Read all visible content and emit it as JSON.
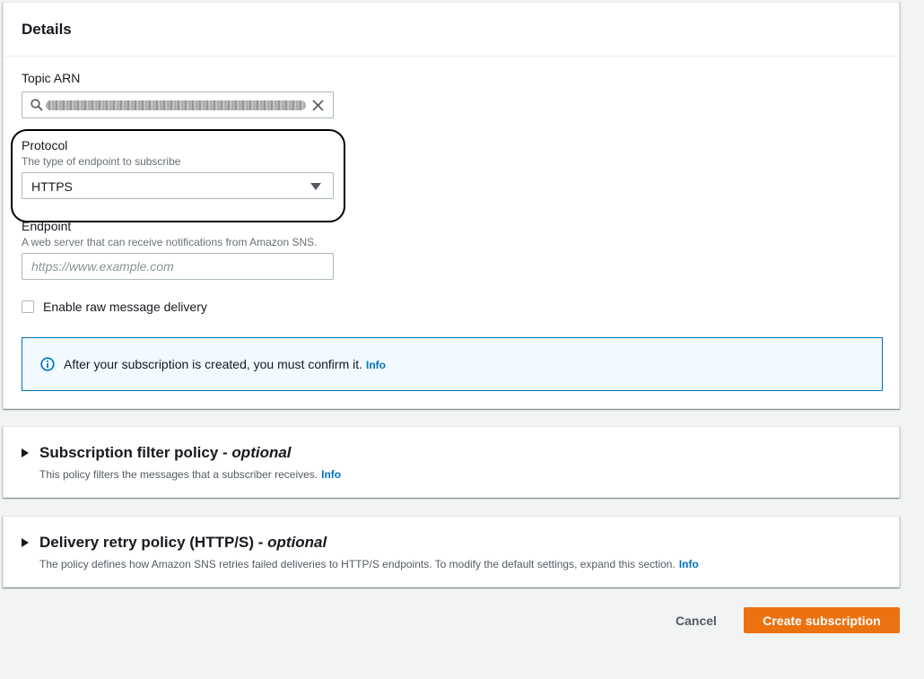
{
  "details": {
    "title": "Details",
    "topic_arn": {
      "label": "Topic ARN"
    },
    "protocol": {
      "label": "Protocol",
      "description": "The type of endpoint to subscribe",
      "selected": "HTTPS"
    },
    "endpoint": {
      "label": "Endpoint",
      "description": "A web server that can receive notifications from Amazon SNS.",
      "placeholder": "https://www.example.com"
    },
    "raw_delivery": {
      "label": "Enable raw message delivery",
      "checked": false
    },
    "alert": {
      "text": "After your subscription is created, you must confirm it.",
      "info_link": "Info"
    }
  },
  "filter_policy": {
    "title": "Subscription filter policy - ",
    "optional": "optional",
    "description": "This policy filters the messages that a subscriber receives.",
    "info_link": "Info"
  },
  "retry_policy": {
    "title": "Delivery retry policy (HTTP/S) - ",
    "optional": "optional",
    "description": "The policy defines how Amazon SNS retries failed deliveries to HTTP/S endpoints. To modify the default settings, expand this section.",
    "info_link": "Info"
  },
  "actions": {
    "cancel": "Cancel",
    "create": "Create subscription"
  },
  "icons": {
    "search": "search-icon",
    "clear": "close-icon",
    "dropdown": "caret-down-icon",
    "info": "info-circle-icon",
    "expand": "caret-right-icon"
  },
  "colors": {
    "primary": "#ec7211",
    "link": "#0073bb",
    "alert_bg": "#f1faff",
    "alert_border": "#0073bb"
  }
}
